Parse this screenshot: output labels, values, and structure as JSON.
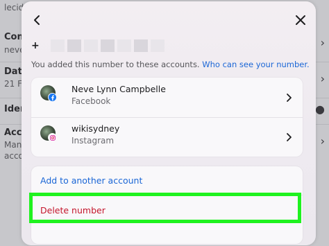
{
  "background": {
    "rows": [
      {
        "text": "lecide",
        "strong": false
      },
      {
        "text": "Con",
        "sub": "neve",
        "strong": true
      },
      {
        "text": "Date",
        "sub": "21 F",
        "strong": true
      },
      {
        "text": "Iden",
        "strong": true
      },
      {
        "text": "Acco",
        "sub": "Man",
        "sub2": "acco",
        "strong": true
      }
    ]
  },
  "modal": {
    "phone_prefix": "+",
    "info_text": "You added this number to these accounts.",
    "info_link": "Who can see your number.",
    "accounts": [
      {
        "name": "Neve Lynn Campbelle",
        "platform": "Facebook",
        "badge": "facebook-icon"
      },
      {
        "name": "wikisydney",
        "platform": "Instagram",
        "badge": "instagram-icon"
      }
    ],
    "actions": {
      "add": "Add to another account",
      "delete": "Delete number"
    }
  },
  "colors": {
    "link": "#1a66d6",
    "danger": "#c4162c",
    "highlight": "#1ff21f",
    "facebook": "#1877f2"
  }
}
